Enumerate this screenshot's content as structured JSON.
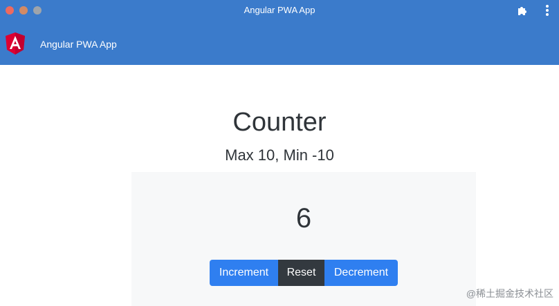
{
  "window": {
    "title": "Angular PWA App"
  },
  "header": {
    "app_name": "Angular PWA App",
    "logo_icon": "angular-logo-icon",
    "extensions_icon": "puzzle-icon",
    "menu_icon": "more-vertical-icon"
  },
  "main": {
    "title": "Counter",
    "subtitle": "Max 10, Min -10",
    "count": "6",
    "buttons": {
      "increment": "Increment",
      "reset": "Reset",
      "decrement": "Decrement"
    }
  },
  "watermark": "@稀土掘金技术社区",
  "colors": {
    "brand_blue": "#3b7bcb",
    "primary_button": "#2f7ff0",
    "dark_button": "#33393f",
    "angular_red": "#dd0031"
  }
}
